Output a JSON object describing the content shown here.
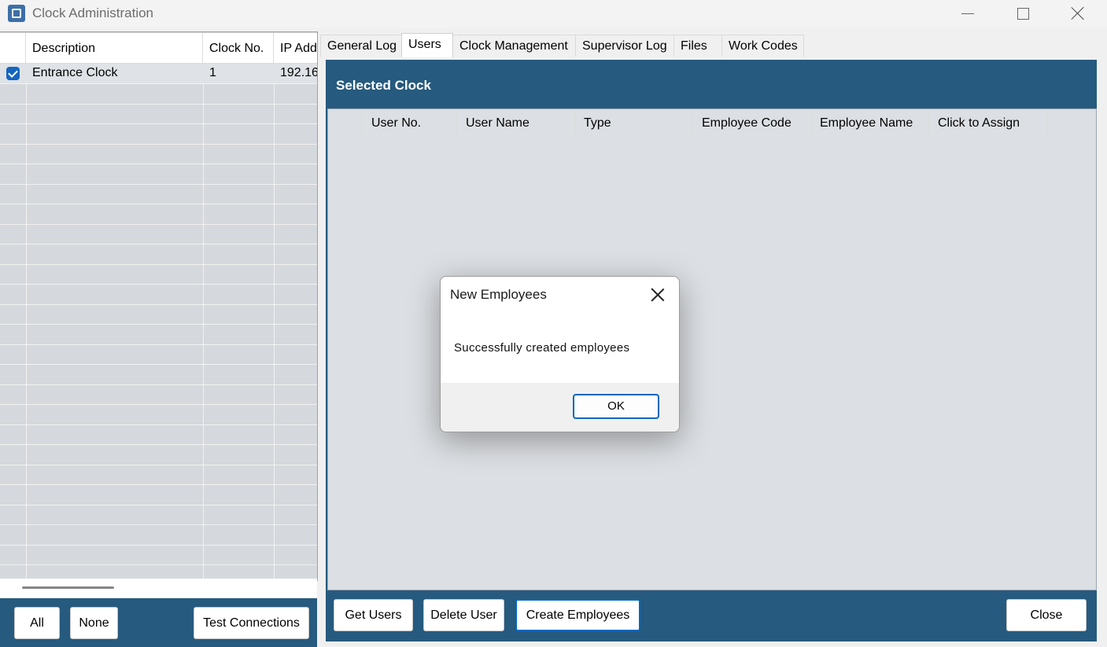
{
  "window": {
    "title": "Clock Administration",
    "icon": "app-logo-icon"
  },
  "clock_list": {
    "columns": [
      "Description",
      "Clock No.",
      "IP Add"
    ],
    "rows": [
      {
        "checked": true,
        "description": "Entrance Clock",
        "clock_no": "1",
        "ip": "192.16"
      }
    ]
  },
  "left_footer": {
    "all_label": "All",
    "none_label": "None",
    "test_label": "Test Connections"
  },
  "tabs": [
    {
      "label": "General Log",
      "active": false
    },
    {
      "label": "Users",
      "active": true
    },
    {
      "label": "Clock Management",
      "active": false
    },
    {
      "label": "Supervisor Log",
      "active": false
    },
    {
      "label": "Files",
      "active": false
    },
    {
      "label": "Work Codes",
      "active": false
    }
  ],
  "users_panel": {
    "title": "Selected Clock",
    "columns": [
      "User No.",
      "User Name",
      "Type",
      "Employee Code",
      "Employee Name",
      "Click to Assign"
    ],
    "rows": []
  },
  "right_footer": {
    "get_users_label": "Get Users",
    "delete_user_label": "Delete User",
    "create_employees_label": "Create Employees",
    "close_label": "Close"
  },
  "dialog": {
    "title": "New Employees",
    "message": "Successfully created employees",
    "ok_label": "OK"
  },
  "colors": {
    "panel_blue": "#265a7e",
    "accent": "#0067c0",
    "checkbox": "#1565c0"
  }
}
